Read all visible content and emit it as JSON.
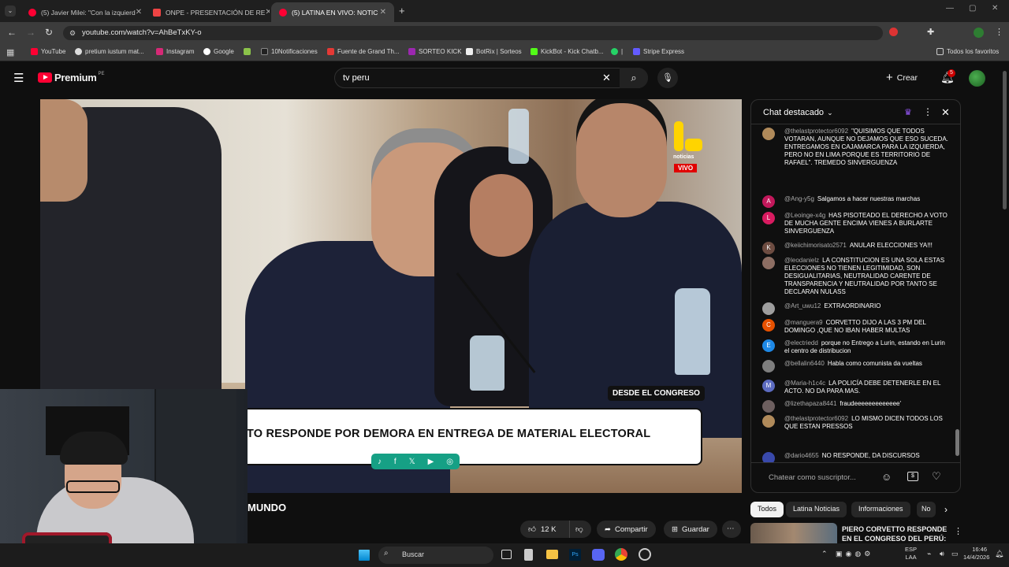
{
  "browser": {
    "tabs": [
      {
        "label": "(5) Javier Milei: \"Con la izquierd"
      },
      {
        "label": "ONPE - PRESENTACIÓN DE RE"
      },
      {
        "label": "(5) LATINA EN VIVO: NOTIC"
      }
    ],
    "url": "youtube.com/watch?v=AhBeTxKY-o",
    "bookmarks": [
      "YouTube",
      "pretium iustum mat...",
      "Instagram",
      "Google",
      "10Notificaciones",
      "Fuente de Grand Th...",
      "SORTEO KICK",
      "BotRix | Sorteos",
      "KickBot - Kick Chatb...",
      "|",
      "Stripe Express"
    ],
    "all_bookmarks": "Todos los favoritos"
  },
  "youtube": {
    "logo": "Premium",
    "logo_sup": "PE",
    "search_value": "tv peru",
    "create_label": "Crear",
    "notif_count": "5"
  },
  "video": {
    "brand": "noticias",
    "live": "VIVO",
    "location_tag": "DESDE EL CONGRESO",
    "headline": "TO RESPONDE POR DEMORA EN ENTREGA DE MATERIAL ELECTORAL",
    "title_fragment": "MUNDO"
  },
  "actions": {
    "likes": "12 K",
    "share": "Compartir",
    "save": "Guardar"
  },
  "chat": {
    "header": "Chat destacado",
    "placeholder": "Chatear como suscriptor...",
    "messages": [
      {
        "author": "@thelastprotector6092",
        "text": "\"QUISIMOS QUE TODOS VOTARAN, AUNQUE NO DEJAMOS QUE ESO SUCEDA. ENTREGAMOS EN CAJAMARCA PARA LA IZQUIERDA, PERO NO EN LIMA PORQUE ES TERRITORIO DE RAFAEL\". TREMEDO SINVERGUENZA",
        "initial": "",
        "color": "#b08a5a"
      },
      {
        "author": "@Ang-y5g",
        "text": "Salgamos a hacer nuestras marchas",
        "initial": "A",
        "color": "#c2185b"
      },
      {
        "author": "@Leoinge-x4g",
        "text": "HAS PISOTEADO EL DERECHO A VOTO DE MUCHA GENTE ENCIMA VIENES A BURLARTE SINVERGUENZA",
        "initial": "L",
        "color": "#d81b60"
      },
      {
        "author": "@keiichimorisato2571",
        "text": "ANULAR ELECCIONES YA!!!",
        "initial": "K",
        "color": "#6d4c41"
      },
      {
        "author": "@leodanielz",
        "text": "LA CONSTITUCION ES UNA SOLA ESTAS ELECCIONES NO TIENEN LEGITIMIDAD, SON DESIGUALITARIAS, NEUTRALIDAD CARENTE DE TRANSPARENCIA Y NEUTRALIDAD POR TANTO SE DECLARAN NULASS",
        "initial": "",
        "color": "#8d6e63"
      },
      {
        "author": "@Art_uwu12",
        "text": "EXTRAORDINARIO",
        "initial": "",
        "color": "#9e9e9e"
      },
      {
        "author": "@manguera9",
        "text": "CORVETTO DIJO A LAS 3 PM DEL DOMINGO ,QUE NO IBAN HABER MULTAS",
        "initial": "C",
        "color": "#e65100"
      },
      {
        "author": "@electriedd",
        "text": "porque no Entrego a Lurin, estando en Lurin el centro de distribucion",
        "initial": "E",
        "color": "#1e88e5"
      },
      {
        "author": "@bellalin6440",
        "text": "Habla como comunista da vueltas",
        "initial": "",
        "color": "#7e7e7e"
      },
      {
        "author": "@Maria-h1c4c",
        "text": "LA POLICÍA DEBE DETENERLE EN EL ACTO. NO DA PARA MAS.",
        "initial": "M",
        "color": "#5c6bc0"
      },
      {
        "author": "@lizethapaza8441",
        "text": "fraudeeeeeeeeeeeee'",
        "initial": "",
        "color": "#6d5f5f"
      },
      {
        "author": "@thelastprotector6092",
        "text": "LO MISMO DICEN TODOS LOS QUE ESTAN PRESSOS",
        "initial": "",
        "color": "#b08a5a"
      },
      {
        "author": "@dario4655",
        "text": "NO RESPONDE, DA DISCURSOS",
        "initial": "",
        "color": "#3949ab"
      }
    ]
  },
  "chips": [
    "Todos",
    "Latina Noticias",
    "Informaciones",
    "No"
  ],
  "related": {
    "title": "PIERO CORVETTO RESPONDE EN EL CONGRESO DEL PERÚ: ..."
  },
  "taskbar": {
    "search": "Buscar",
    "lang1": "ESP",
    "lang2": "LAA",
    "time": "16:46",
    "date": "14/4/2026"
  }
}
